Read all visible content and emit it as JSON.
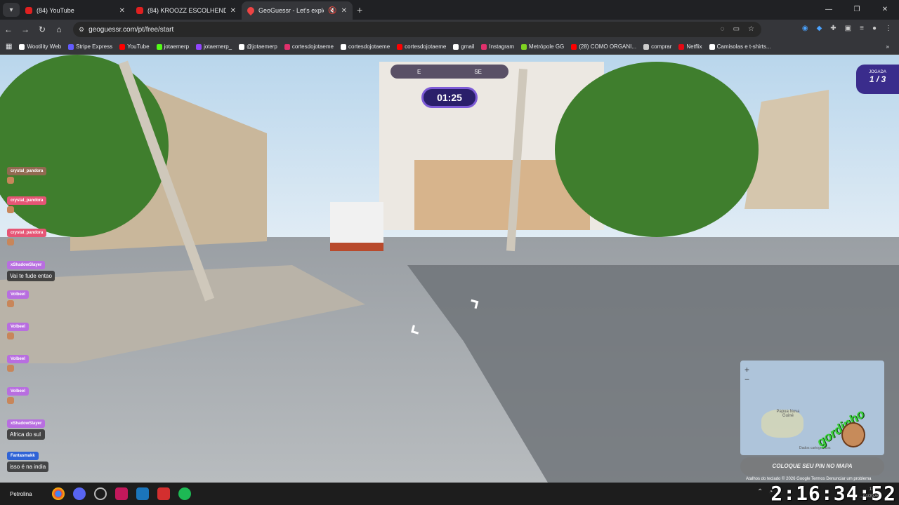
{
  "browser": {
    "tabs": [
      {
        "title": "(84) YouTube",
        "icon": "youtube-icon",
        "active": false
      },
      {
        "title": "(84) KROOZZ ESCOLHENDO UM",
        "icon": "youtube-icon",
        "active": false
      },
      {
        "title": "GeoGuessr - Let's explore th",
        "icon": "geoguessr-pin-icon",
        "active": true
      }
    ],
    "url": "geoguessr.com/pt/free/start",
    "bookmarks": [
      {
        "label": "Wootility Web",
        "color": "#ffffff"
      },
      {
        "label": "Stripe Express",
        "color": "#635bff"
      },
      {
        "label": "YouTube",
        "color": "#ff0000"
      },
      {
        "label": "jotaemerp",
        "color": "#53fc18"
      },
      {
        "label": "jotaemerp_",
        "color": "#9146ff"
      },
      {
        "label": "@jotaemerp",
        "color": "#ffffff"
      },
      {
        "label": "cortesdojotaeme",
        "color": "#e1306c"
      },
      {
        "label": "cortesdojotaeme",
        "color": "#ffffff"
      },
      {
        "label": "cortesdojotaeme",
        "color": "#ff0000"
      },
      {
        "label": "gmail",
        "color": "#ffffff"
      },
      {
        "label": "Instagram",
        "color": "#e1306c"
      },
      {
        "label": "Metrópole GG",
        "color": "#7fd321"
      },
      {
        "label": "(28) COMO ORGANI...",
        "color": "#ff0000"
      },
      {
        "label": "comprar",
        "color": "#cccccc"
      },
      {
        "label": "Netflix",
        "color": "#e50914"
      },
      {
        "label": "Camisolas e t-shirts...",
        "color": "#ffffff"
      }
    ]
  },
  "game": {
    "compass": {
      "east": "E",
      "southeast": "SE"
    },
    "timer": "01:25",
    "round": {
      "label": "JOGADA",
      "value": "1 / 3"
    },
    "map": {
      "place_label": "Papua Nova Guiné",
      "credit": "Dados cartográficos",
      "guess_button": "COLOQUE SEU PIN NO MAPA"
    },
    "footer": "Atalhos do teclado  © 2026 Google  Termos  Denunciar um problema"
  },
  "chat": [
    {
      "user": "crystal_pandora",
      "emote": true,
      "style": "faded"
    },
    {
      "user": "crystal_pandora",
      "emote": true,
      "style": "pink"
    },
    {
      "user": "crystal_pandora",
      "emote": true,
      "style": "pink"
    },
    {
      "user": "xShadowSlayer",
      "text": "Vai te fude entao",
      "style": "purple"
    },
    {
      "user": "Volbeel",
      "emote": true,
      "style": "purple"
    },
    {
      "user": "Volbeel",
      "emote": true,
      "style": "purple"
    },
    {
      "user": "Volbeel",
      "emote": true,
      "style": "purple"
    },
    {
      "user": "Volbeel",
      "emote": true,
      "style": "purple"
    },
    {
      "user": "xShadowSlayer",
      "text": "Africa do sul",
      "style": "purple"
    },
    {
      "user": "Fantasmakk",
      "text": "isso é na india",
      "style": "blue"
    }
  ],
  "stream_overlay": {
    "watermark_text": "gordinho",
    "clock": "2:16:34:52"
  },
  "taskbar": {
    "weather_city": "Petrolina",
    "system_time": "11:...",
    "system_date": "...01/2026"
  }
}
